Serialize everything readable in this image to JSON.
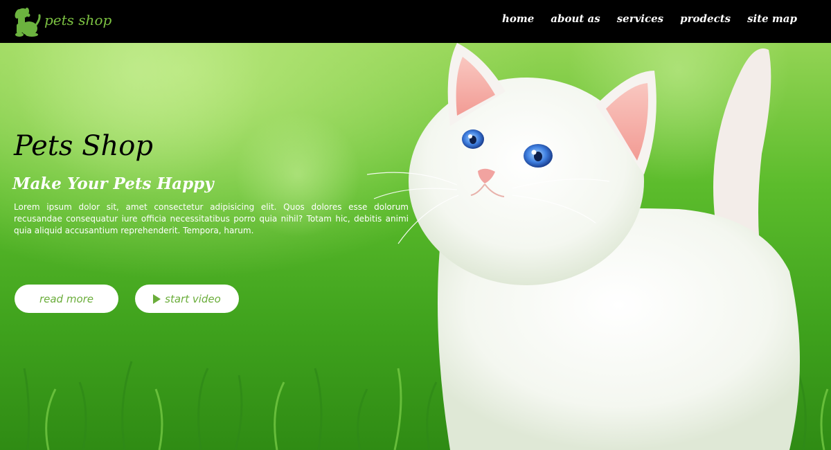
{
  "brand": {
    "name": "pets shop",
    "logo_icon": "dog-icon",
    "color": "#7cc242"
  },
  "nav": {
    "items": [
      {
        "label": "home"
      },
      {
        "label": "about as"
      },
      {
        "label": "services"
      },
      {
        "label": "prodects"
      },
      {
        "label": "site map"
      }
    ]
  },
  "hero": {
    "title": "Pets Shop",
    "subtitle": "Make Your Pets Happy",
    "body": "Lorem ipsum dolor sit, amet consectetur adipisicing elit. Quos dolores esse dolorum recusandae consequatur iure officia necessitatibus porro quia nihil? Totam hic, debitis animi quia aliquid accusantium reprehenderit. Tempora, harum.",
    "image_subject": "white-kitten",
    "buttons": {
      "read_more": "read more",
      "start_video": "start video",
      "start_video_icon": "play-icon"
    }
  },
  "colors": {
    "header_bg": "#000000",
    "accent_green": "#7cc242",
    "button_text": "#6aad3a",
    "button_bg": "#ffffff"
  }
}
